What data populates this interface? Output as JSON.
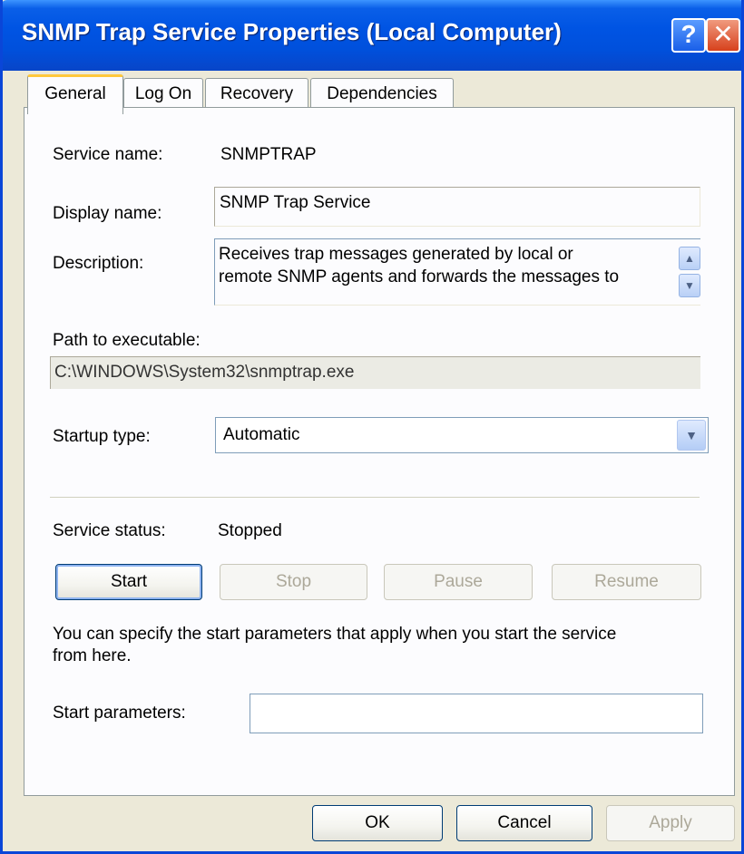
{
  "window": {
    "title": "SNMP Trap Service Properties (Local Computer)",
    "help_glyph": "?",
    "close_glyph": "✕"
  },
  "tabs": [
    {
      "label": "General",
      "active": true
    },
    {
      "label": "Log On",
      "active": false
    },
    {
      "label": "Recovery",
      "active": false
    },
    {
      "label": "Dependencies",
      "active": false
    }
  ],
  "general": {
    "service_name_label": "Service name:",
    "service_name_value": "SNMPTRAP",
    "display_name_label": "Display name:",
    "display_name_value": "SNMP Trap Service",
    "description_label": "Description:",
    "description_value": "Receives trap messages generated by local or\nremote SNMP agents and forwards the messages to",
    "path_label": "Path to executable:",
    "path_value": "C:\\WINDOWS\\System32\\snmptrap.exe",
    "startup_type_label": "Startup type:",
    "startup_type_value": "Automatic",
    "service_status_label": "Service status:",
    "service_status_value": "Stopped",
    "start_button": "Start",
    "stop_button": "Stop",
    "pause_button": "Pause",
    "resume_button": "Resume",
    "hint_text": "You can specify the start parameters that apply when you start the service\nfrom here.",
    "start_params_label": "Start parameters:",
    "start_params_value": ""
  },
  "footer": {
    "ok_button": "OK",
    "cancel_button": "Cancel",
    "apply_button": "Apply"
  },
  "icons": {
    "scroll_up": "▲",
    "scroll_down": "▼",
    "dropdown": "▼"
  },
  "colors": {
    "titlebar": "#0054e3",
    "active_tab_accent": "#ffc83c",
    "dialog_background": "#ece9d8",
    "panel_background": "#fcfcfe"
  }
}
